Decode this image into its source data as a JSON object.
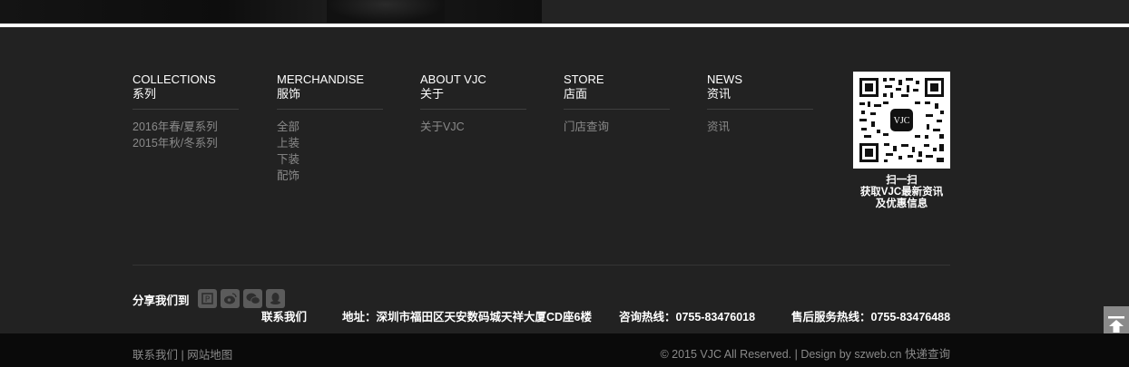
{
  "columns": [
    {
      "en": "COLLECTIONS",
      "cn": "系列",
      "items": [
        "2016年春/夏系列",
        "2015年秋/冬系列"
      ]
    },
    {
      "en": "MERCHANDISE",
      "cn": "服饰",
      "items": [
        "全部",
        "上装",
        "下装",
        "配饰"
      ]
    },
    {
      "en": "ABOUT VJC",
      "cn": "关于",
      "items": [
        "关于VJC"
      ]
    },
    {
      "en": "STORE",
      "cn": "店面",
      "items": [
        "门店查询"
      ]
    },
    {
      "en": "NEWS",
      "cn": "资讯",
      "items": [
        "资讯"
      ]
    }
  ],
  "qr": {
    "logo_text": "VJC",
    "caption_line1": "扫一扫",
    "caption_line2": "获取VJC最新资讯",
    "caption_line3": "及优惠信息"
  },
  "share": {
    "label": "分享我们到",
    "icons": [
      "douban-icon",
      "weibo-icon",
      "wechat-icon",
      "qq-icon"
    ]
  },
  "contact": {
    "title": "联系我们",
    "address": "地址：深圳市福田区天安数码城天祥大厦CD座6楼",
    "hotline": "咨询热线：0755-83476018",
    "aftersale": "售后服务热线：0755-83476488"
  },
  "bottom": {
    "link1": "联系我们",
    "separator": " | ",
    "link2": "网站地图",
    "copyright": "© 2015 VJC All Reserved. | Design by szweb.cn",
    "link3": "快递查询"
  },
  "colors": {
    "background": "#222222",
    "bottom_bar": "#0a0a0a",
    "link_gray": "#8a8a8a"
  }
}
